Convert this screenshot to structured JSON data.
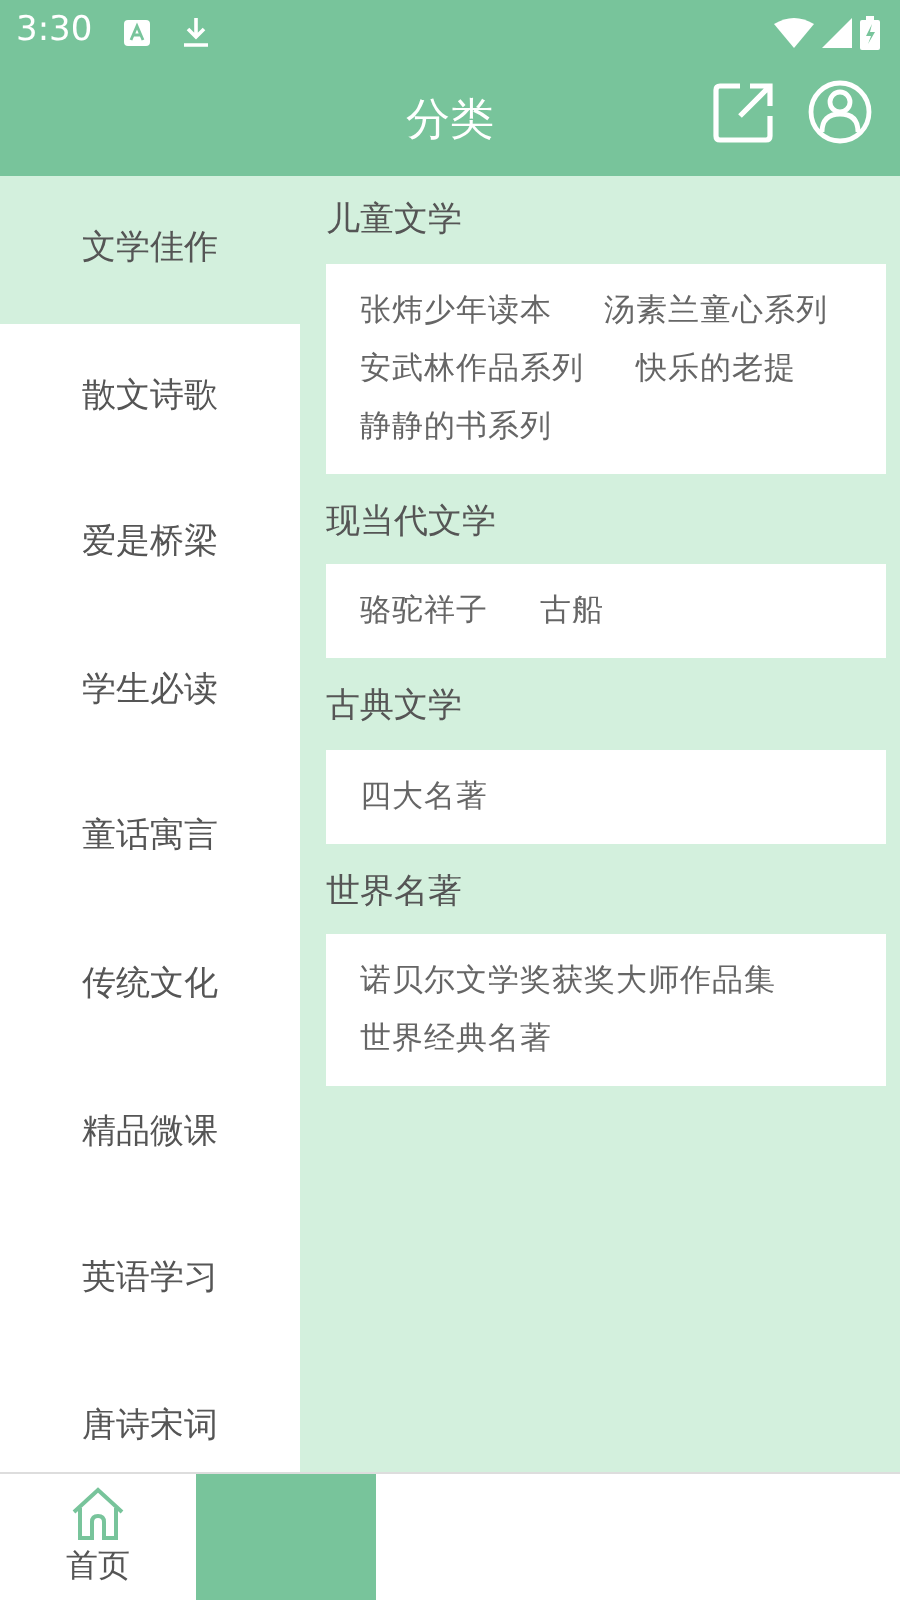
{
  "status_bar": {
    "time": "3:30"
  },
  "header": {
    "title": "分类"
  },
  "sidebar": {
    "items": [
      {
        "label": "文学佳作",
        "selected": true
      },
      {
        "label": "散文诗歌",
        "selected": false
      },
      {
        "label": "爱是桥梁",
        "selected": false
      },
      {
        "label": "学生必读",
        "selected": false
      },
      {
        "label": "童话寓言",
        "selected": false
      },
      {
        "label": "传统文化",
        "selected": false
      },
      {
        "label": "精品微课",
        "selected": false
      },
      {
        "label": "英语学习",
        "selected": false
      },
      {
        "label": "唐诗宋词",
        "selected": false
      }
    ]
  },
  "sections": [
    {
      "title": "儿童文学",
      "items": [
        "张炜少年读本",
        "汤素兰童心系列",
        "安武林作品系列",
        "快乐的老提",
        "静静的书系列"
      ]
    },
    {
      "title": "现当代文学",
      "items": [
        "骆驼祥子",
        "古船"
      ]
    },
    {
      "title": "古典文学",
      "items": [
        "四大名著"
      ]
    },
    {
      "title": "世界名著",
      "items": [
        "诺贝尔文学奖获奖大师作品集",
        "世界经典名著"
      ]
    }
  ],
  "bottom_nav": [
    {
      "label": "首页",
      "selected": false
    },
    {
      "selected": true
    }
  ]
}
